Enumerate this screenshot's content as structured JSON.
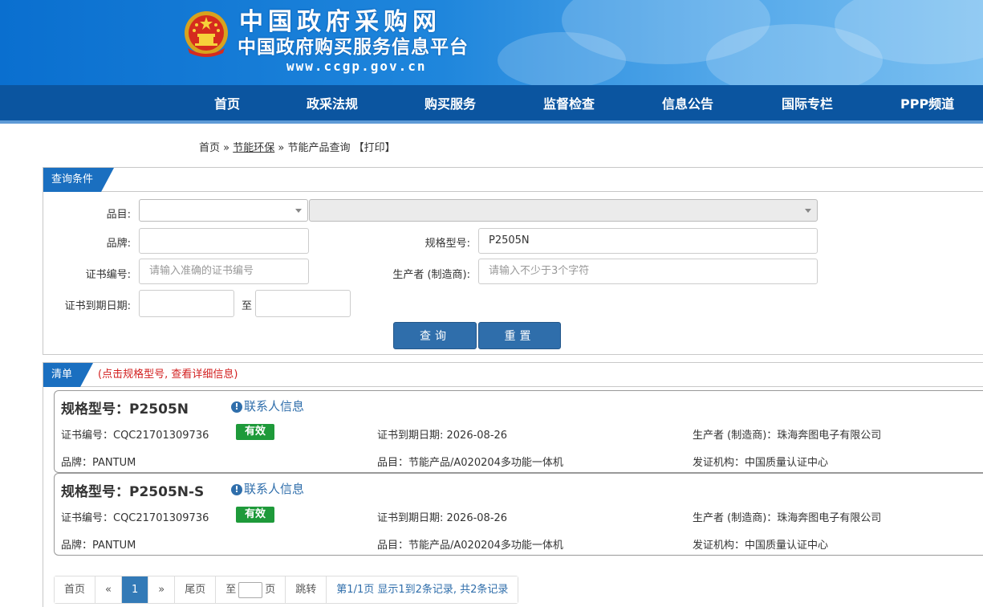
{
  "header": {
    "title": "中国政府采购网",
    "subtitle": "中国政府购买服务信息平台",
    "url": "www.ccgp.gov.cn"
  },
  "nav": [
    "首页",
    "政采法规",
    "购买服务",
    "监督检查",
    "信息公告",
    "国际专栏",
    "PPP频道"
  ],
  "breadcrumb": {
    "home": "首页",
    "sep1": " » ",
    "section": "节能环保",
    "sep2": " » ",
    "page": "节能产品查询",
    "print": "【打印】"
  },
  "query": {
    "tab": "查询条件",
    "category_label": "品目:",
    "brand_label": "品牌:",
    "model_label": "规格型号:",
    "model_value": "P2505N",
    "cert_label": "证书编号:",
    "cert_placeholder": "请输入准确的证书编号",
    "maker_label": "生产者  (制造商):",
    "maker_placeholder": "请输入不少于3个字符",
    "expire_label": "证书到期日期:",
    "to": "至",
    "search_btn": "查询",
    "reset_btn": "重置"
  },
  "list": {
    "tab": "清单",
    "note": "(点击规格型号, 查看详细信息)",
    "items": [
      {
        "model": "规格型号：P2505N",
        "contact": "联系人信息",
        "cert": "证书编号：CQC21701309736",
        "status": "有效",
        "expire": "证书到期日期: 2026-08-26",
        "maker": "生产者  (制造商)：珠海奔图电子有限公司",
        "brand": "品牌：PANTUM",
        "category": "品目：节能产品/A020204多功能一体机",
        "issuer": "发证机构：中国质量认证中心"
      },
      {
        "model": "规格型号：P2505N-S",
        "contact": "联系人信息",
        "cert": "证书编号：CQC21701309736",
        "status": "有效",
        "expire": "证书到期日期: 2026-08-26",
        "maker": "生产者  (制造商)：珠海奔图电子有限公司",
        "brand": "品牌：PANTUM",
        "category": "品目：节能产品/A020204多功能一体机",
        "issuer": "发证机构：中国质量认证中心"
      }
    ]
  },
  "pager": {
    "first": "首页",
    "prev": "«",
    "current": "1",
    "next": "»",
    "last": "尾页",
    "to": "至",
    "page_unit": "页",
    "jump": "跳转",
    "info": "第1/1页  显示1到2条记录, 共2条记录"
  },
  "colors": {
    "nav_bg": "#0b55a0",
    "accent": "#2f6eab",
    "valid": "#1e9a3a",
    "note": "#d21f1f"
  }
}
